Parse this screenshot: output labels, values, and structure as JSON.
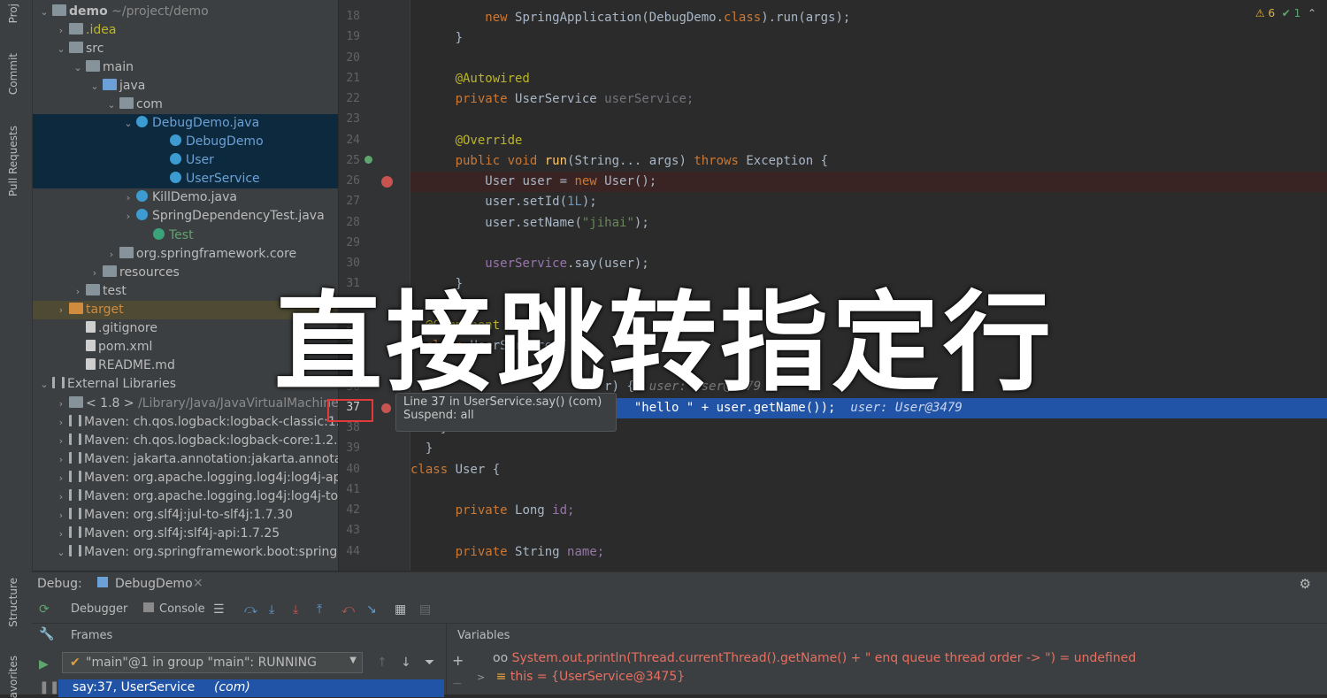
{
  "side_tabs": {
    "project": "Proj",
    "commit": "Commit",
    "pull_requests": "Pull Requests",
    "structure": "Structure",
    "favorites": "avorites"
  },
  "project_tree": [
    {
      "label": "demo",
      "suffix": "~/project/demo",
      "indent": 0,
      "arrow": "v",
      "icon": "folder",
      "bold": true
    },
    {
      "label": ".idea",
      "indent": 1,
      "arrow": ">",
      "icon": "folder",
      "color": "yellow"
    },
    {
      "label": "src",
      "indent": 1,
      "arrow": "v",
      "icon": "folder"
    },
    {
      "label": "main",
      "indent": 2,
      "arrow": "v",
      "icon": "folder"
    },
    {
      "label": "java",
      "indent": 3,
      "arrow": "v",
      "icon": "folder blue"
    },
    {
      "label": "com",
      "indent": 4,
      "arrow": "v",
      "icon": "package"
    },
    {
      "label": "DebugDemo.java",
      "indent": 5,
      "arrow": "v",
      "icon": "cls",
      "color": "blue",
      "selected": true
    },
    {
      "label": "DebugDemo",
      "indent": 7,
      "arrow": "",
      "icon": "cls",
      "color": "blue",
      "selected": true
    },
    {
      "label": "User",
      "indent": 7,
      "arrow": "",
      "icon": "cls",
      "color": "blue",
      "selected": true
    },
    {
      "label": "UserService",
      "indent": 7,
      "arrow": "",
      "icon": "cls",
      "color": "blue",
      "selected": true
    },
    {
      "label": "KillDemo.java",
      "indent": 5,
      "arrow": ">",
      "icon": "cls"
    },
    {
      "label": "SpringDependencyTest.java",
      "indent": 5,
      "arrow": ">",
      "icon": "cls"
    },
    {
      "label": "Test",
      "indent": 6,
      "arrow": "",
      "icon": "cls green",
      "color": "green"
    },
    {
      "label": "org.springframework.core",
      "indent": 4,
      "arrow": ">",
      "icon": "package"
    },
    {
      "label": "resources",
      "indent": 3,
      "arrow": ">",
      "icon": "folder"
    },
    {
      "label": "test",
      "indent": 2,
      "arrow": ">",
      "icon": "folder"
    },
    {
      "label": "target",
      "indent": 1,
      "arrow": ">",
      "icon": "folder orange",
      "color": "orange",
      "target": true
    },
    {
      "label": ".gitignore",
      "indent": 2,
      "arrow": "",
      "icon": "file"
    },
    {
      "label": "pom.xml",
      "indent": 2,
      "arrow": "",
      "icon": "maven"
    },
    {
      "label": "README.md",
      "indent": 2,
      "arrow": "",
      "icon": "file"
    },
    {
      "label": "External Libraries",
      "indent": 0,
      "arrow": "v",
      "icon": "lib"
    },
    {
      "label": "< 1.8 >",
      "suffix": "/Library/Java/JavaVirtualMachines/",
      "indent": 1,
      "arrow": ">",
      "icon": "folder"
    },
    {
      "label": "Maven: ch.qos.logback:logback-classic:1.2",
      "indent": 1,
      "arrow": ">",
      "icon": "lib"
    },
    {
      "label": "Maven: ch.qos.logback:logback-core:1.2.3",
      "indent": 1,
      "arrow": ">",
      "icon": "lib"
    },
    {
      "label": "Maven: jakarta.annotation:jakarta.annotatio",
      "indent": 1,
      "arrow": ">",
      "icon": "lib"
    },
    {
      "label": "Maven: org.apache.logging.log4j:log4j-api:",
      "indent": 1,
      "arrow": ">",
      "icon": "lib"
    },
    {
      "label": "Maven: org.apache.logging.log4j:log4j-to-s",
      "indent": 1,
      "arrow": ">",
      "icon": "lib"
    },
    {
      "label": "Maven: org.slf4j:jul-to-slf4j:1.7.30",
      "indent": 1,
      "arrow": ">",
      "icon": "lib"
    },
    {
      "label": "Maven: org.slf4j:slf4j-api:1.7.25",
      "indent": 1,
      "arrow": ">",
      "icon": "lib"
    },
    {
      "label": "Maven: org.springframework.boot:spring-b",
      "indent": 1,
      "arrow": "v",
      "icon": "lib"
    }
  ],
  "editor": {
    "line_numbers": [
      "18",
      "19",
      "20",
      "21",
      "22",
      "23",
      "24",
      "25",
      "26",
      "27",
      "28",
      "29",
      "30",
      "31",
      "32",
      "33",
      "34",
      "35",
      "36",
      "37",
      "38",
      "39",
      "40",
      "41",
      "42",
      "43",
      "44"
    ],
    "lines": {
      "l18_a": "new ",
      "l18_b": "SpringApplication(DebugDemo.",
      "l18_c": "class",
      "l18_d": ").run(args);",
      "l19": "}",
      "l21": "@Autowired",
      "l22_a": "private ",
      "l22_b": "UserService ",
      "l22_c": "userService;",
      "l24": "@Override",
      "l25_a": "public void ",
      "l25_b": "run",
      "l25_c": "(String... args) ",
      "l25_d": "throws ",
      "l25_e": "Exception {",
      "l26_a": "User user = ",
      "l26_b": "new ",
      "l26_c": "User();",
      "l27_a": "user.setId(",
      "l27_b": "1L",
      "l27_c": ");",
      "l28_a": "user.setName(",
      "l28_b": "\"jihai\"",
      "l28_c": ");",
      "l30_a": "userService",
      "l30_b": ".say(user);",
      "l31": "}",
      "l33": "@Component",
      "l34_a": "class ",
      "l34_b": "UserService {",
      "l36_a": "r) {",
      "l36_hint": "user: User@3479",
      "l37_a": "\"hello \" ",
      "l37_b": "+ user.getName());",
      "l37_hint": "user: User@3479",
      "l38": "}",
      "l39": "}",
      "l40_a": "class ",
      "l40_b": "User {",
      "l42_a": "private ",
      "l42_b": "Long ",
      "l42_c": "id;",
      "l44_a": "private ",
      "l44_b": "String ",
      "l44_c": "name;"
    }
  },
  "tooltip": {
    "line1": "Line 37 in UserService.say() (com)",
    "line2": "Suspend: all"
  },
  "caption": "直接跳转指定行",
  "inspections": {
    "warnings": "⚠ 6",
    "checks": "✔ 1",
    "up": "⌃"
  },
  "debug": {
    "title": "Debug:",
    "tab": "DebugDemo",
    "tab_close": "×",
    "debugger_tab": "Debugger",
    "console_tab": "Console",
    "frames_label": "Frames",
    "variables_label": "Variables",
    "thread_select": "\"main\"@1 in group \"main\": RUNNING",
    "frame_item": "say:37, UserService",
    "frame_item_pkg": "(com)",
    "watch_expr": "System.out.println(Thread.currentThread().getName() + \" enq queue thread order -> \") = undefined",
    "var_this": "this = {UserService@3475}"
  },
  "colors": {
    "accent": "#2154a6",
    "breakpoint": "#c75450",
    "highlight_box": "#e23a3a"
  }
}
